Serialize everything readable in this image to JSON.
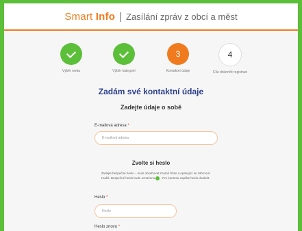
{
  "header": {
    "brand": "Smart",
    "brand_bold": "Info",
    "separator": "|",
    "subtitle": "Zasílání zpráv z obcí a měst"
  },
  "steps": [
    {
      "number": "",
      "caption": "Výběr webu",
      "state": "done"
    },
    {
      "number": "",
      "caption": "Výběr kategorií",
      "state": "done"
    },
    {
      "number": "3",
      "caption": "Kontaktní údaje",
      "state": "active"
    },
    {
      "number": "4",
      "caption": "Cíle dokončit registraci",
      "state": "todo"
    }
  ],
  "main": {
    "title": "Zadám své kontaktní údaje",
    "subtitle": "Zadejte údaje o sobě",
    "email": {
      "label": "E-mailová adresa",
      "required": "*",
      "placeholder": "E-mailová adresa"
    },
    "password_section": {
      "heading": "Zvolte si heslo",
      "description": "Zadejte bezpečné heslo – musí obsahovat znamé fráze a opakující se zahrnout znaků. Bezpečné heslo bude označeno",
      "description_tail": ". Pro kontrolu napište heslo dvakrát."
    },
    "password": {
      "label": "Heslo",
      "required": "*",
      "placeholder": "Heslo"
    },
    "password_again": {
      "label": "Heslo znovu",
      "required": "*"
    }
  },
  "colors": {
    "frame": "#5cbf3a",
    "accent": "#f07b1e",
    "title": "#2b3f8c"
  }
}
